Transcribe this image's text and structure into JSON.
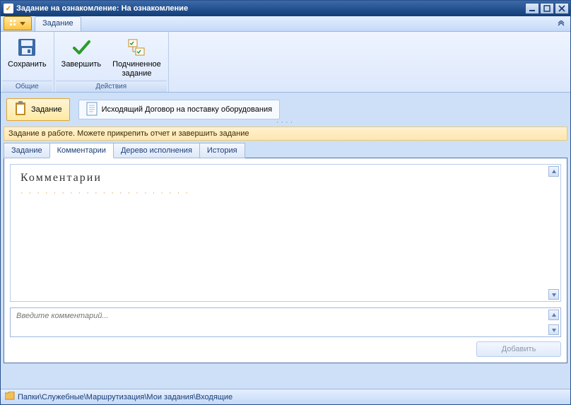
{
  "window": {
    "title": "Задание на ознакомление: На ознакомление"
  },
  "ribbon": {
    "tab_label": "Задание",
    "groups": {
      "common": {
        "label": "Общие",
        "save": "Сохранить"
      },
      "actions": {
        "label": "Действия",
        "complete": "Завершить",
        "subtask_line1": "Подчиненное",
        "subtask_line2": "задание"
      }
    }
  },
  "object_bar": {
    "task_button": "Задание",
    "linked_doc": "Исходящий Договор на поставку оборудования"
  },
  "status": {
    "message": "Задание в работе. Можете прикрепить отчет и завершить задание"
  },
  "tabs": {
    "items": [
      {
        "label": "Задание"
      },
      {
        "label": "Комментарии"
      },
      {
        "label": "Дерево исполнения"
      },
      {
        "label": "История"
      }
    ],
    "active_index": 1
  },
  "comments": {
    "heading": "Комментарии",
    "input_placeholder": "Введите комментарий...",
    "add_button": "Добавить"
  },
  "footer": {
    "breadcrumb": "Папки\\Служебные\\Маршрутизация\\Мои задания\\Входящие"
  }
}
